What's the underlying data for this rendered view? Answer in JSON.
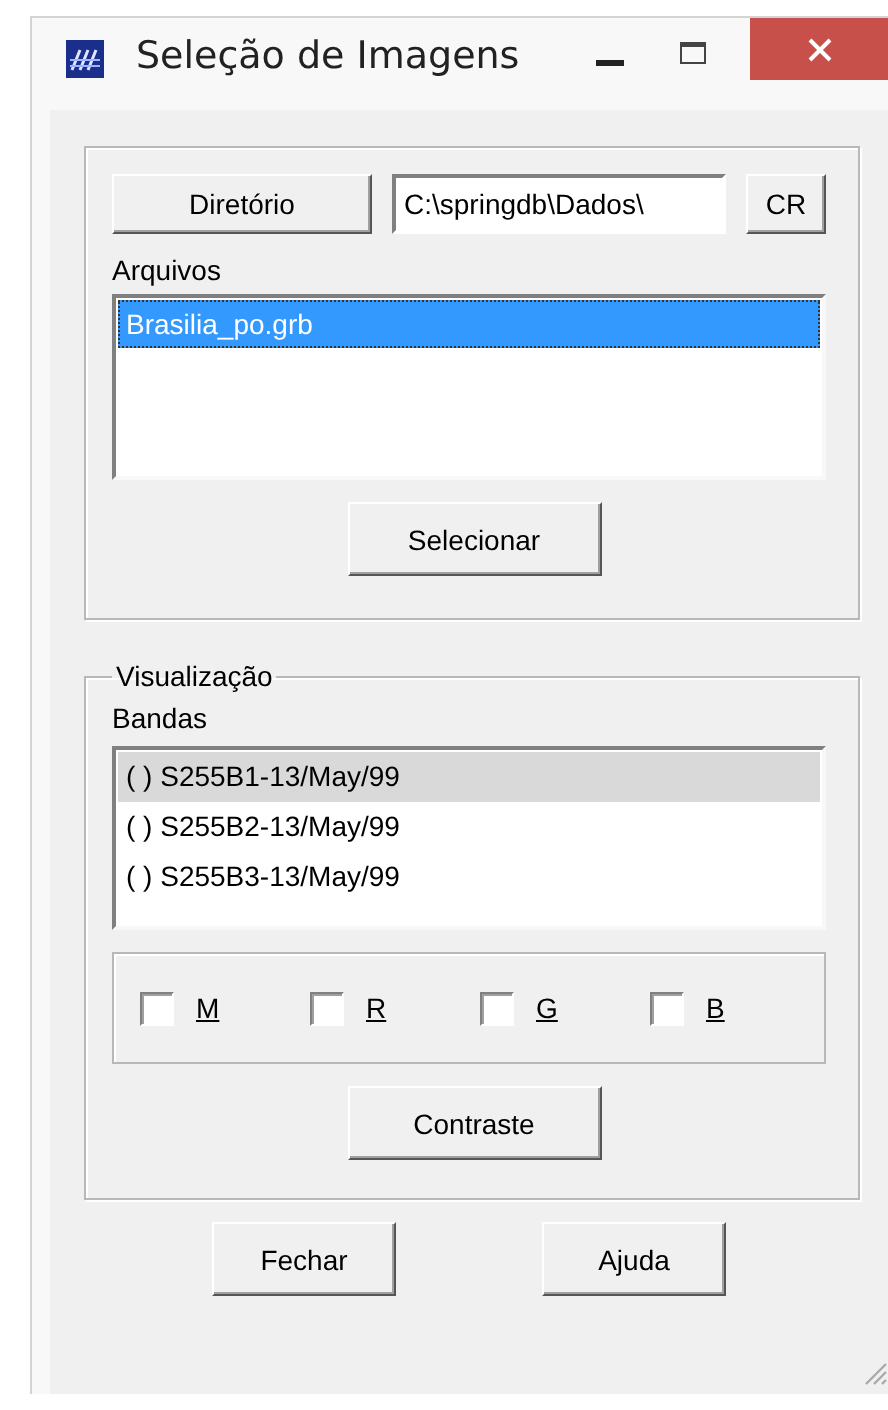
{
  "window": {
    "title": "Seleção de Imagens"
  },
  "directory": {
    "button": "Diretório",
    "path": "C:\\springdb\\Dados\\",
    "cr_button": "CR"
  },
  "files": {
    "label": "Arquivos",
    "items": [
      {
        "name": "Brasilia_po.grb",
        "selected": true
      }
    ],
    "button": "Selecionar"
  },
  "visualization": {
    "title": "Visualização",
    "bands_label": "Bandas",
    "bands": [
      {
        "name": "( ) S255B1-13/May/99",
        "selected": true
      },
      {
        "name": "( ) S255B2-13/May/99",
        "selected": false
      },
      {
        "name": "( ) S255B3-13/May/99",
        "selected": false
      }
    ],
    "channels": [
      {
        "label": "M",
        "checked": false
      },
      {
        "label": "R",
        "checked": false
      },
      {
        "label": "G",
        "checked": false
      },
      {
        "label": "B",
        "checked": false
      }
    ],
    "button": "Contraste"
  },
  "buttons": [
    "Fechar",
    "Ajuda"
  ]
}
